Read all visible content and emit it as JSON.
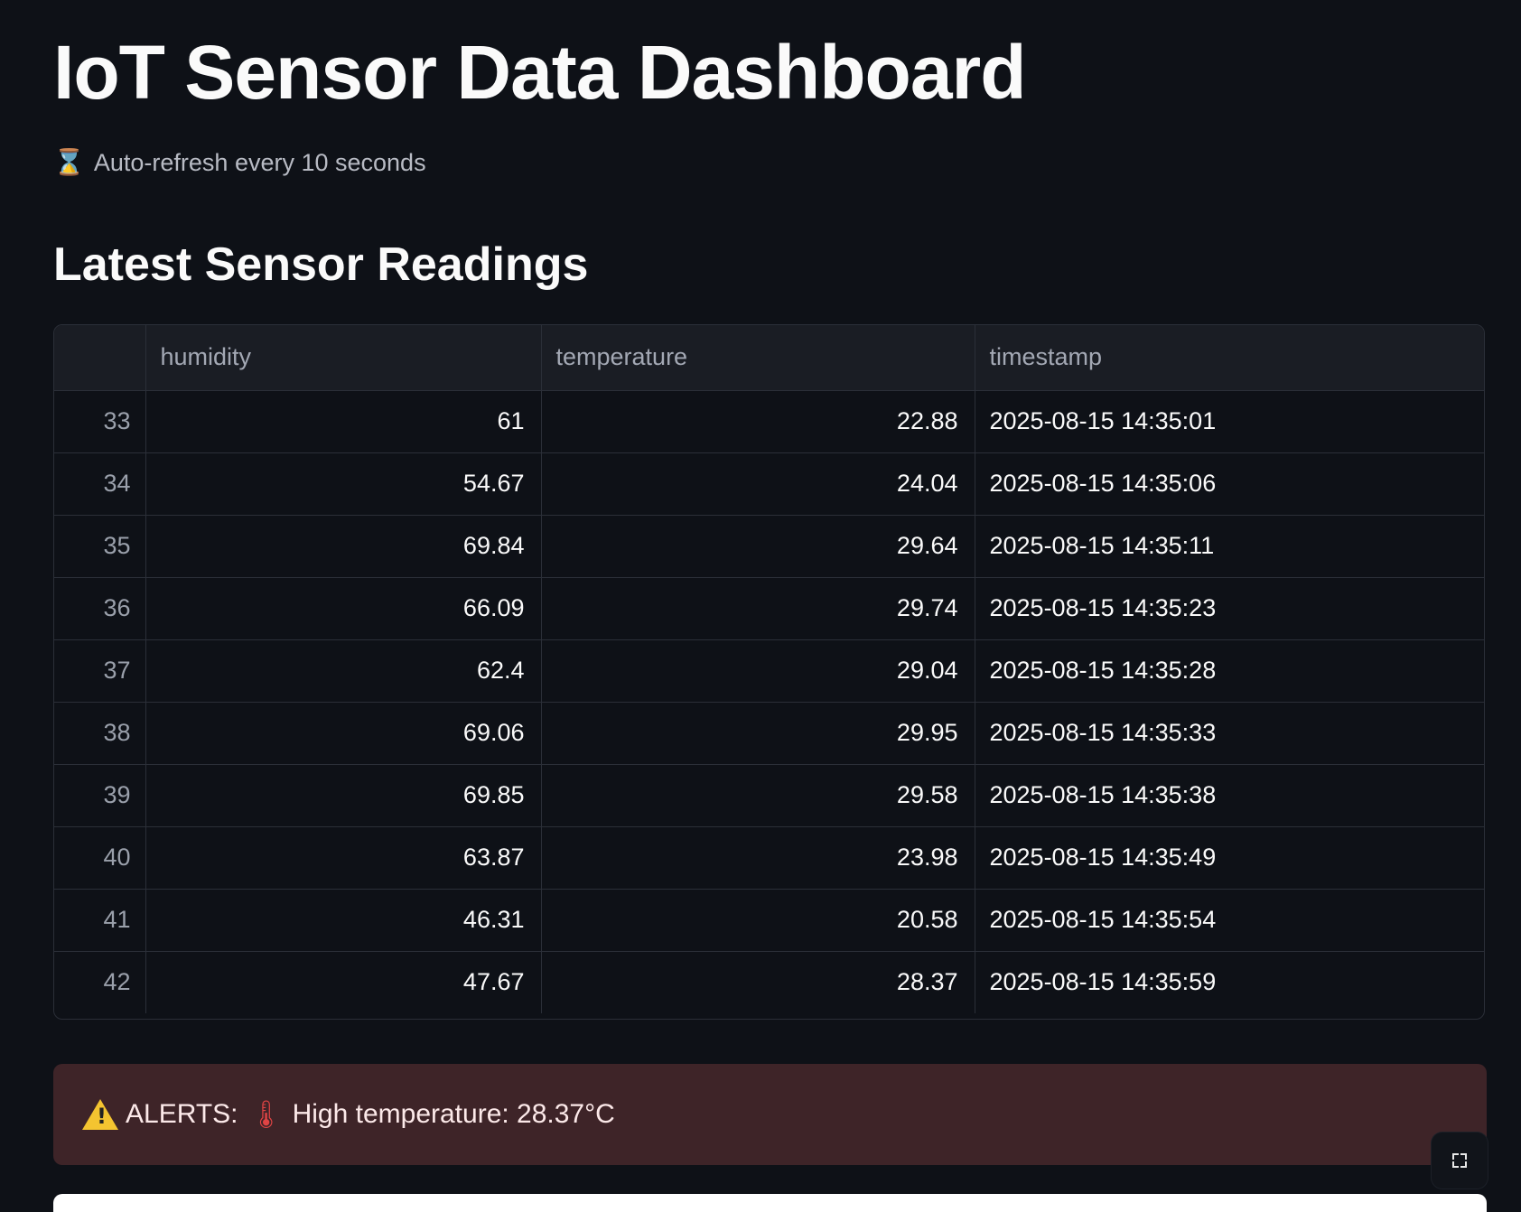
{
  "header": {
    "title": "IoT Sensor Data Dashboard",
    "refresh_icon": "hourglass-icon",
    "refresh_text": "Auto-refresh every 10 seconds"
  },
  "section": {
    "title": "Latest Sensor Readings"
  },
  "table": {
    "columns": [
      "",
      "humidity",
      "temperature",
      "timestamp"
    ],
    "rows": [
      {
        "index": "33",
        "humidity": "61",
        "temperature": "22.88",
        "timestamp": "2025-08-15 14:35:01"
      },
      {
        "index": "34",
        "humidity": "54.67",
        "temperature": "24.04",
        "timestamp": "2025-08-15 14:35:06"
      },
      {
        "index": "35",
        "humidity": "69.84",
        "temperature": "29.64",
        "timestamp": "2025-08-15 14:35:11"
      },
      {
        "index": "36",
        "humidity": "66.09",
        "temperature": "29.74",
        "timestamp": "2025-08-15 14:35:23"
      },
      {
        "index": "37",
        "humidity": "62.4",
        "temperature": "29.04",
        "timestamp": "2025-08-15 14:35:28"
      },
      {
        "index": "38",
        "humidity": "69.06",
        "temperature": "29.95",
        "timestamp": "2025-08-15 14:35:33"
      },
      {
        "index": "39",
        "humidity": "69.85",
        "temperature": "29.58",
        "timestamp": "2025-08-15 14:35:38"
      },
      {
        "index": "40",
        "humidity": "63.87",
        "temperature": "23.98",
        "timestamp": "2025-08-15 14:35:49"
      },
      {
        "index": "41",
        "humidity": "46.31",
        "temperature": "20.58",
        "timestamp": "2025-08-15 14:35:54"
      },
      {
        "index": "42",
        "humidity": "47.67",
        "temperature": "28.37",
        "timestamp": "2025-08-15 14:35:59"
      }
    ]
  },
  "alert": {
    "warning_icon": "warning-icon",
    "label": "ALERTS:",
    "thermometer_icon": "thermometer-icon",
    "message": "High temperature: 28.37°C"
  },
  "fullscreen": {
    "icon": "fullscreen-icon"
  },
  "colors": {
    "background": "#0e1117",
    "alert_background": "#3e2428",
    "table_header": "#1a1d24",
    "grid_line": "#2b2f38"
  }
}
